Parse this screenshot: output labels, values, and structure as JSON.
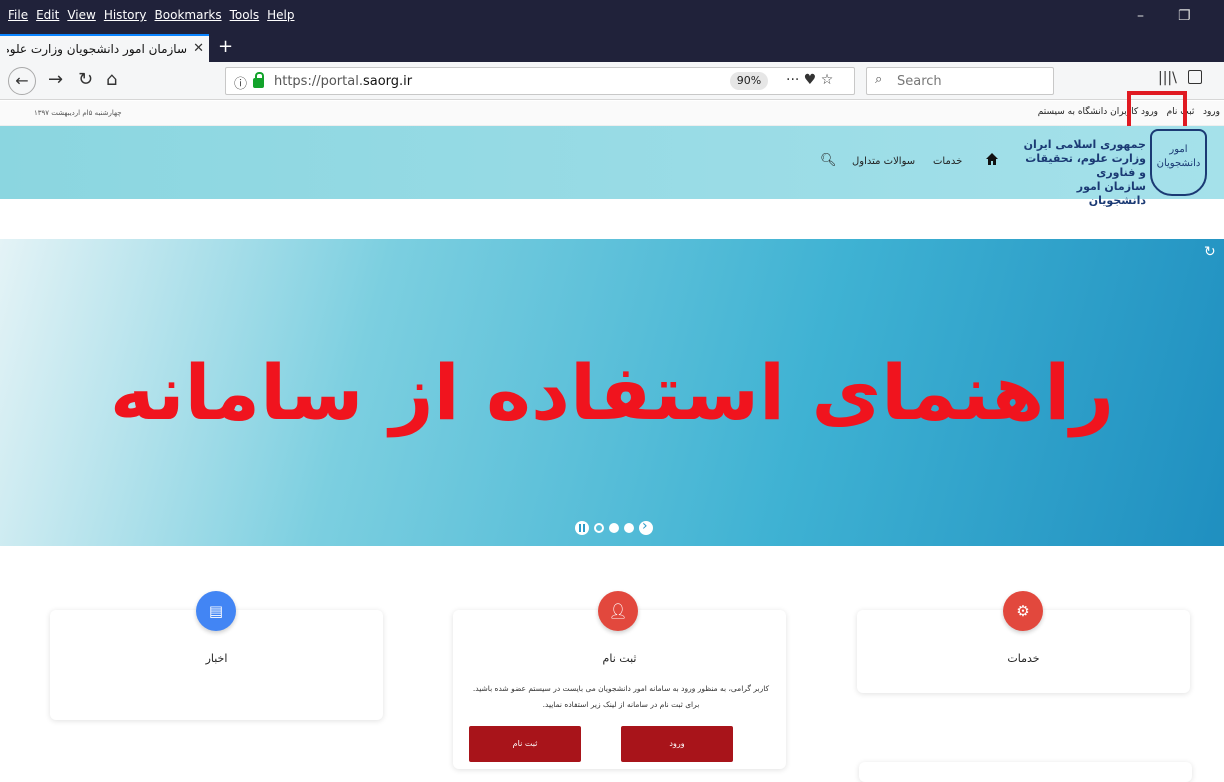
{
  "browser": {
    "menu": [
      "File",
      "Edit",
      "View",
      "History",
      "Bookmarks",
      "Tools",
      "Help"
    ],
    "tab_title": "سازمان امور دانشجویان وزارت علوم، تحقیقات و فناوری",
    "url_prefix": "https://portal.",
    "url_domain": "saorg.ir",
    "zoom": "90%",
    "search_placeholder": "Search",
    "window_controls": {
      "minimize": "–",
      "restore": "❐"
    }
  },
  "site": {
    "date": "چهارشنبه ۵ام اردیبهشت ۱۳۹۷",
    "top_links": {
      "login": "ورود",
      "register": "ثبت نام",
      "university_login": "ورود کاربران دانشگاه به سیستم"
    },
    "logo_glyph": "امور دانشجویان",
    "logo_text": [
      "جمهوری اسلامی ایران",
      "وزارت علوم، تحقیقات و فناوری",
      "سازمان امور دانشجویان"
    ],
    "nav": {
      "services": "خدمات",
      "faq": "سوالات متداول"
    },
    "hero_title": "راهنمای استفاده از سامانه",
    "cards": {
      "news": {
        "title": "اخبار",
        "icon": "news-icon"
      },
      "register": {
        "title": "ثبت نام",
        "icon": "add-user-icon",
        "description": "کاربر گرامی، به منظور ورود به سامانه امور دانشجویان می بایست در سیستم عضو شده باشید. برای ثبت نام در سامانه از لینک زیر استفاده نمایید.",
        "login_button": "ورود",
        "signup_button": "ثبت نام"
      },
      "services": {
        "title": "خدمات",
        "icon": "gear-icon"
      }
    },
    "colors": {
      "accent_red": "#a8141a",
      "highlight_box": "#e01a22",
      "hero_text": "#f0141e",
      "header_bg": "#9adce6"
    }
  }
}
